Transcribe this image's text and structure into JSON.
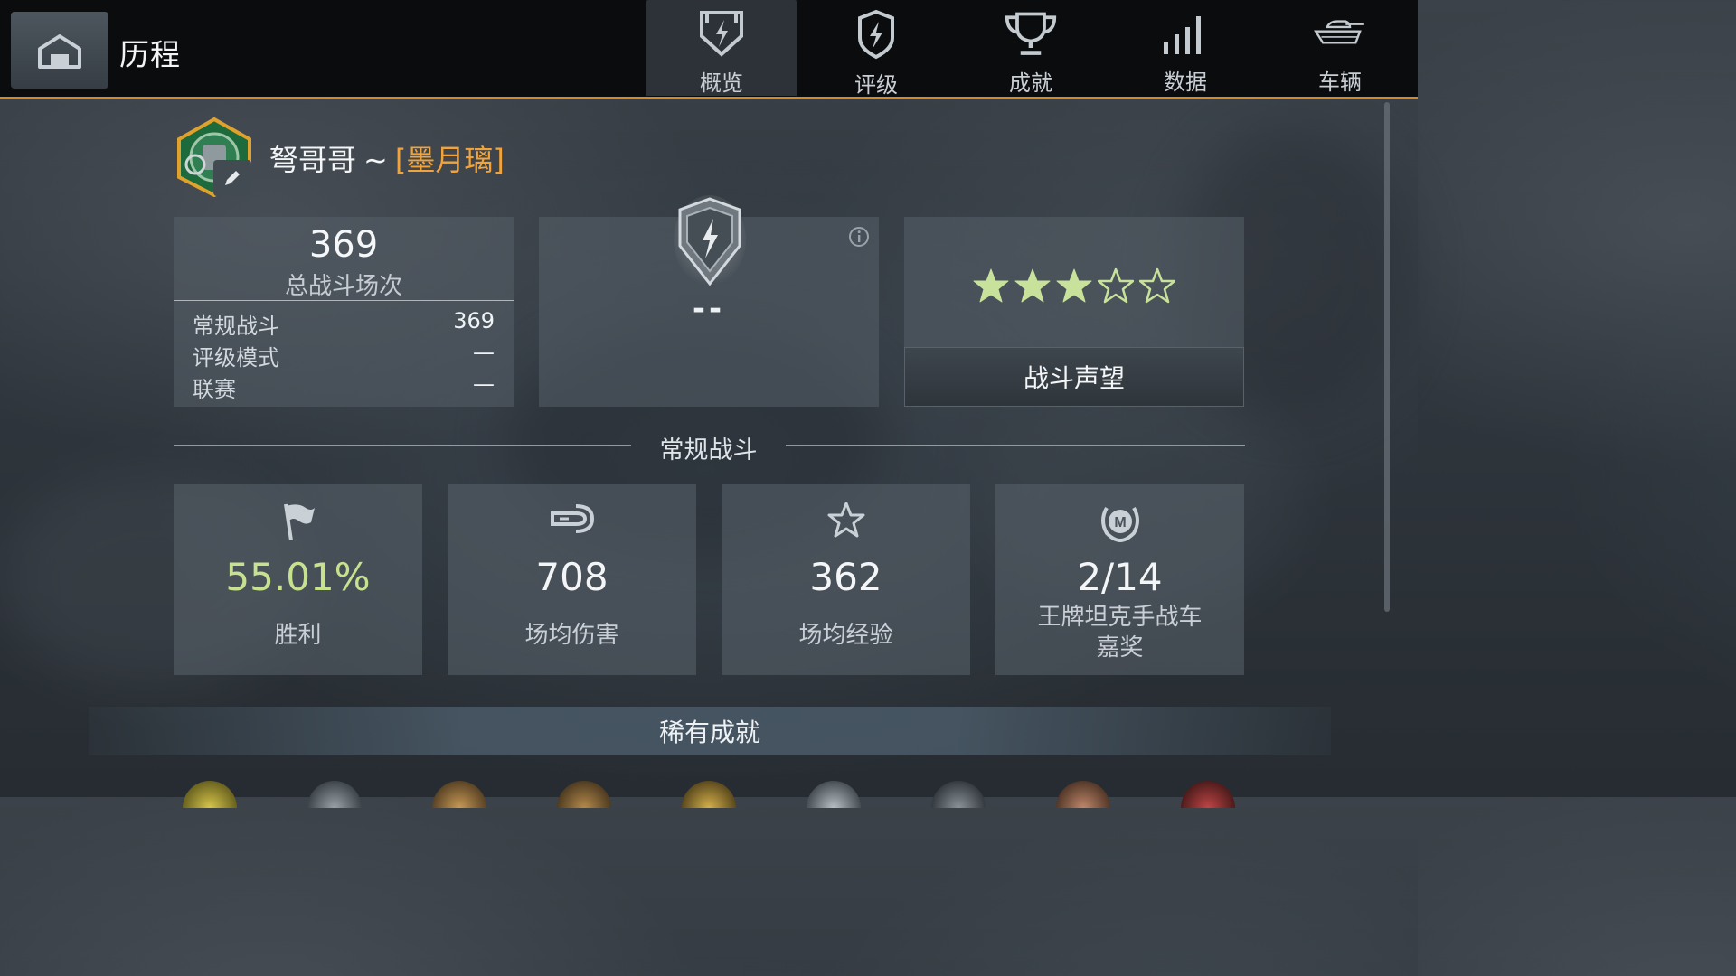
{
  "header": {
    "title": "历程",
    "tabs": [
      {
        "label": "概览",
        "icon": "overview-shield-icon",
        "active": true
      },
      {
        "label": "评级",
        "icon": "rating-shield-icon",
        "active": false
      },
      {
        "label": "成就",
        "icon": "trophy-icon",
        "active": false
      },
      {
        "label": "数据",
        "icon": "bar-chart-icon",
        "active": false
      },
      {
        "label": "车辆",
        "icon": "tank-icon",
        "active": false
      }
    ]
  },
  "profile": {
    "name": "弩哥哥",
    "separator": "~",
    "clan": "[墨月璃]"
  },
  "battles": {
    "total": "369",
    "caption": "总战斗场次",
    "rows": [
      {
        "label": "常规战斗",
        "value": "369"
      },
      {
        "label": "评级模式",
        "value": "—"
      },
      {
        "label": "联赛",
        "value": "—"
      }
    ]
  },
  "rating": {
    "value": "--"
  },
  "prestige": {
    "stars_filled": 3,
    "stars_total": 5,
    "button_label": "战斗声望"
  },
  "section": {
    "title": "常规战斗"
  },
  "stats": [
    {
      "value": "55.01%",
      "label": "胜利",
      "icon": "flag-icon"
    },
    {
      "value": "708",
      "label": "场均伤害",
      "icon": "shell-damage-icon"
    },
    {
      "value": "362",
      "label": "场均经验",
      "icon": "star-icon"
    },
    {
      "value": "2/14",
      "label": "王牌坦克手战车嘉奖",
      "label_line1": "王牌坦克手战车",
      "label_line2": "嘉奖",
      "icon": "mastery-badge-icon"
    }
  ],
  "rare": {
    "title": "稀有成就"
  },
  "colors": {
    "accent": "#d58a2a",
    "clan": "#f2a43a",
    "win_rate": "#c6e28f",
    "star_filled": "#c8e29b"
  }
}
